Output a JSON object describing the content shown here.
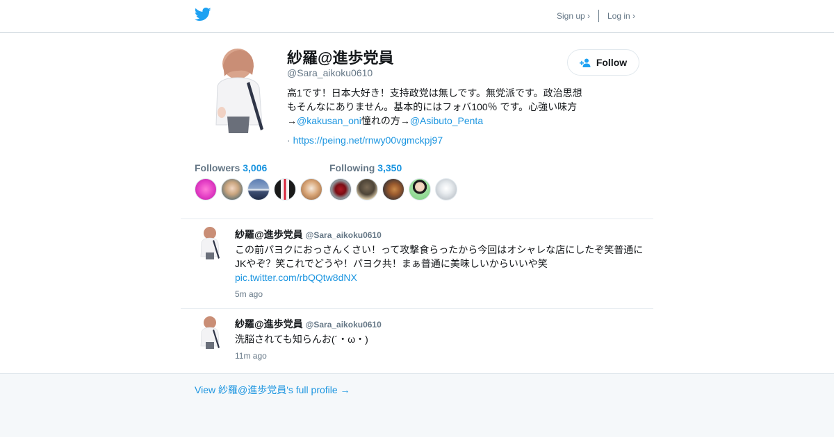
{
  "header": {
    "signup_label": "Sign up ›",
    "login_label": "Log in ›"
  },
  "profile": {
    "name": "紗羅@進歩党員",
    "handle": "@Sara_aikoku0610",
    "bio_text": "高1です！日本大好き！支持政党は無しです。無党派です。政治思想もそんなにありません。基本的にはフォバ100％ です。心強い味方→",
    "bio_mention_1": "@kakusan_oni",
    "bio_mid": "憧れの方→",
    "bio_mention_2": "@Asibuto_Penta",
    "url_prefix": "·",
    "url": "https://peing.net/rnwy00vgmckpj97",
    "follow_label": "Follow"
  },
  "stats": {
    "followers_label": "Followers",
    "followers_count": "3,006",
    "following_label": "Following",
    "following_count": "3,350"
  },
  "tweets": [
    {
      "name": "紗羅@進歩党員",
      "handle": "@Sara_aikoku0610",
      "text": "この前パヨクにおっさんくさい！って攻撃食らったから今回はオシャレな店にしたぞ笑普通にJKやぞ？笑これでどうや！パヨク共！まぁ普通に美味しいからいいや笑",
      "link": "pic.twitter.com/rbQQtw8dNX",
      "time": "5m ago"
    },
    {
      "name": "紗羅@進歩党員",
      "handle": "@Sara_aikoku0610",
      "text": "洗脳されても知らんお(´・ω・)",
      "time": "11m ago"
    }
  ],
  "footer": {
    "link_label": "View 紗羅@進歩党員's full profile →"
  },
  "colors": {
    "twitter_blue": "#1da1f2",
    "link_blue": "#1b95e0",
    "secondary_gray": "#657786",
    "footer_bg": "#f5f8fa"
  },
  "icons": {
    "logo": "twitter-bird-icon",
    "follow": "add-person-icon"
  }
}
